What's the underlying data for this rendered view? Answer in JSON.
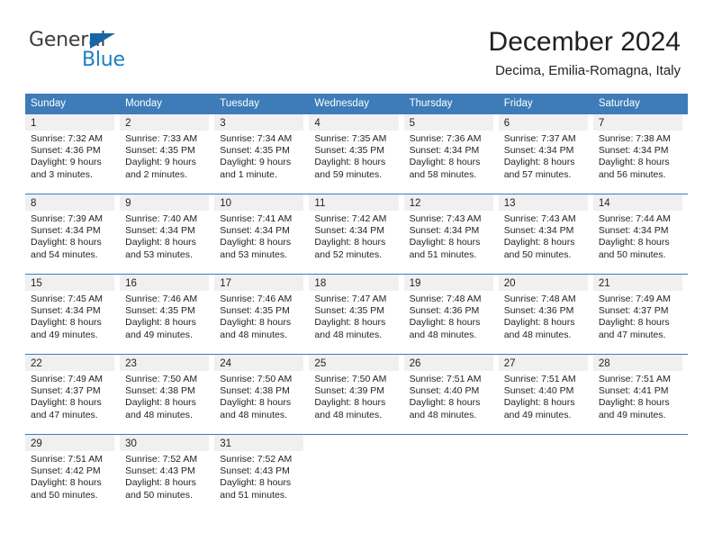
{
  "brand": {
    "name_part1": "General",
    "name_part2": "Blue",
    "triangle_color": "#1565a8",
    "blue_color": "#1b7fc4",
    "gray_color": "#3c3c3b"
  },
  "header": {
    "title": "December 2024",
    "subtitle": "Decima, Emilia-Romagna, Italy"
  },
  "theme": {
    "header_blue": "#3d7cb8",
    "daynum_band": "#f0f0f0",
    "text": "#231f20"
  },
  "weekdays": [
    "Sunday",
    "Monday",
    "Tuesday",
    "Wednesday",
    "Thursday",
    "Friday",
    "Saturday"
  ],
  "weeks": [
    [
      {
        "day": "1",
        "l1": "Sunrise: 7:32 AM",
        "l2": "Sunset: 4:36 PM",
        "l3": "Daylight: 9 hours",
        "l4": "and 3 minutes."
      },
      {
        "day": "2",
        "l1": "Sunrise: 7:33 AM",
        "l2": "Sunset: 4:35 PM",
        "l3": "Daylight: 9 hours",
        "l4": "and 2 minutes."
      },
      {
        "day": "3",
        "l1": "Sunrise: 7:34 AM",
        "l2": "Sunset: 4:35 PM",
        "l3": "Daylight: 9 hours",
        "l4": "and 1 minute."
      },
      {
        "day": "4",
        "l1": "Sunrise: 7:35 AM",
        "l2": "Sunset: 4:35 PM",
        "l3": "Daylight: 8 hours",
        "l4": "and 59 minutes."
      },
      {
        "day": "5",
        "l1": "Sunrise: 7:36 AM",
        "l2": "Sunset: 4:34 PM",
        "l3": "Daylight: 8 hours",
        "l4": "and 58 minutes."
      },
      {
        "day": "6",
        "l1": "Sunrise: 7:37 AM",
        "l2": "Sunset: 4:34 PM",
        "l3": "Daylight: 8 hours",
        "l4": "and 57 minutes."
      },
      {
        "day": "7",
        "l1": "Sunrise: 7:38 AM",
        "l2": "Sunset: 4:34 PM",
        "l3": "Daylight: 8 hours",
        "l4": "and 56 minutes."
      }
    ],
    [
      {
        "day": "8",
        "l1": "Sunrise: 7:39 AM",
        "l2": "Sunset: 4:34 PM",
        "l3": "Daylight: 8 hours",
        "l4": "and 54 minutes."
      },
      {
        "day": "9",
        "l1": "Sunrise: 7:40 AM",
        "l2": "Sunset: 4:34 PM",
        "l3": "Daylight: 8 hours",
        "l4": "and 53 minutes."
      },
      {
        "day": "10",
        "l1": "Sunrise: 7:41 AM",
        "l2": "Sunset: 4:34 PM",
        "l3": "Daylight: 8 hours",
        "l4": "and 53 minutes."
      },
      {
        "day": "11",
        "l1": "Sunrise: 7:42 AM",
        "l2": "Sunset: 4:34 PM",
        "l3": "Daylight: 8 hours",
        "l4": "and 52 minutes."
      },
      {
        "day": "12",
        "l1": "Sunrise: 7:43 AM",
        "l2": "Sunset: 4:34 PM",
        "l3": "Daylight: 8 hours",
        "l4": "and 51 minutes."
      },
      {
        "day": "13",
        "l1": "Sunrise: 7:43 AM",
        "l2": "Sunset: 4:34 PM",
        "l3": "Daylight: 8 hours",
        "l4": "and 50 minutes."
      },
      {
        "day": "14",
        "l1": "Sunrise: 7:44 AM",
        "l2": "Sunset: 4:34 PM",
        "l3": "Daylight: 8 hours",
        "l4": "and 50 minutes."
      }
    ],
    [
      {
        "day": "15",
        "l1": "Sunrise: 7:45 AM",
        "l2": "Sunset: 4:34 PM",
        "l3": "Daylight: 8 hours",
        "l4": "and 49 minutes."
      },
      {
        "day": "16",
        "l1": "Sunrise: 7:46 AM",
        "l2": "Sunset: 4:35 PM",
        "l3": "Daylight: 8 hours",
        "l4": "and 49 minutes."
      },
      {
        "day": "17",
        "l1": "Sunrise: 7:46 AM",
        "l2": "Sunset: 4:35 PM",
        "l3": "Daylight: 8 hours",
        "l4": "and 48 minutes."
      },
      {
        "day": "18",
        "l1": "Sunrise: 7:47 AM",
        "l2": "Sunset: 4:35 PM",
        "l3": "Daylight: 8 hours",
        "l4": "and 48 minutes."
      },
      {
        "day": "19",
        "l1": "Sunrise: 7:48 AM",
        "l2": "Sunset: 4:36 PM",
        "l3": "Daylight: 8 hours",
        "l4": "and 48 minutes."
      },
      {
        "day": "20",
        "l1": "Sunrise: 7:48 AM",
        "l2": "Sunset: 4:36 PM",
        "l3": "Daylight: 8 hours",
        "l4": "and 48 minutes."
      },
      {
        "day": "21",
        "l1": "Sunrise: 7:49 AM",
        "l2": "Sunset: 4:37 PM",
        "l3": "Daylight: 8 hours",
        "l4": "and 47 minutes."
      }
    ],
    [
      {
        "day": "22",
        "l1": "Sunrise: 7:49 AM",
        "l2": "Sunset: 4:37 PM",
        "l3": "Daylight: 8 hours",
        "l4": "and 47 minutes."
      },
      {
        "day": "23",
        "l1": "Sunrise: 7:50 AM",
        "l2": "Sunset: 4:38 PM",
        "l3": "Daylight: 8 hours",
        "l4": "and 48 minutes."
      },
      {
        "day": "24",
        "l1": "Sunrise: 7:50 AM",
        "l2": "Sunset: 4:38 PM",
        "l3": "Daylight: 8 hours",
        "l4": "and 48 minutes."
      },
      {
        "day": "25",
        "l1": "Sunrise: 7:50 AM",
        "l2": "Sunset: 4:39 PM",
        "l3": "Daylight: 8 hours",
        "l4": "and 48 minutes."
      },
      {
        "day": "26",
        "l1": "Sunrise: 7:51 AM",
        "l2": "Sunset: 4:40 PM",
        "l3": "Daylight: 8 hours",
        "l4": "and 48 minutes."
      },
      {
        "day": "27",
        "l1": "Sunrise: 7:51 AM",
        "l2": "Sunset: 4:40 PM",
        "l3": "Daylight: 8 hours",
        "l4": "and 49 minutes."
      },
      {
        "day": "28",
        "l1": "Sunrise: 7:51 AM",
        "l2": "Sunset: 4:41 PM",
        "l3": "Daylight: 8 hours",
        "l4": "and 49 minutes."
      }
    ],
    [
      {
        "day": "29",
        "l1": "Sunrise: 7:51 AM",
        "l2": "Sunset: 4:42 PM",
        "l3": "Daylight: 8 hours",
        "l4": "and 50 minutes."
      },
      {
        "day": "30",
        "l1": "Sunrise: 7:52 AM",
        "l2": "Sunset: 4:43 PM",
        "l3": "Daylight: 8 hours",
        "l4": "and 50 minutes."
      },
      {
        "day": "31",
        "l1": "Sunrise: 7:52 AM",
        "l2": "Sunset: 4:43 PM",
        "l3": "Daylight: 8 hours",
        "l4": "and 51 minutes."
      },
      {
        "day": "",
        "l1": "",
        "l2": "",
        "l3": "",
        "l4": ""
      },
      {
        "day": "",
        "l1": "",
        "l2": "",
        "l3": "",
        "l4": ""
      },
      {
        "day": "",
        "l1": "",
        "l2": "",
        "l3": "",
        "l4": ""
      },
      {
        "day": "",
        "l1": "",
        "l2": "",
        "l3": "",
        "l4": ""
      }
    ]
  ]
}
